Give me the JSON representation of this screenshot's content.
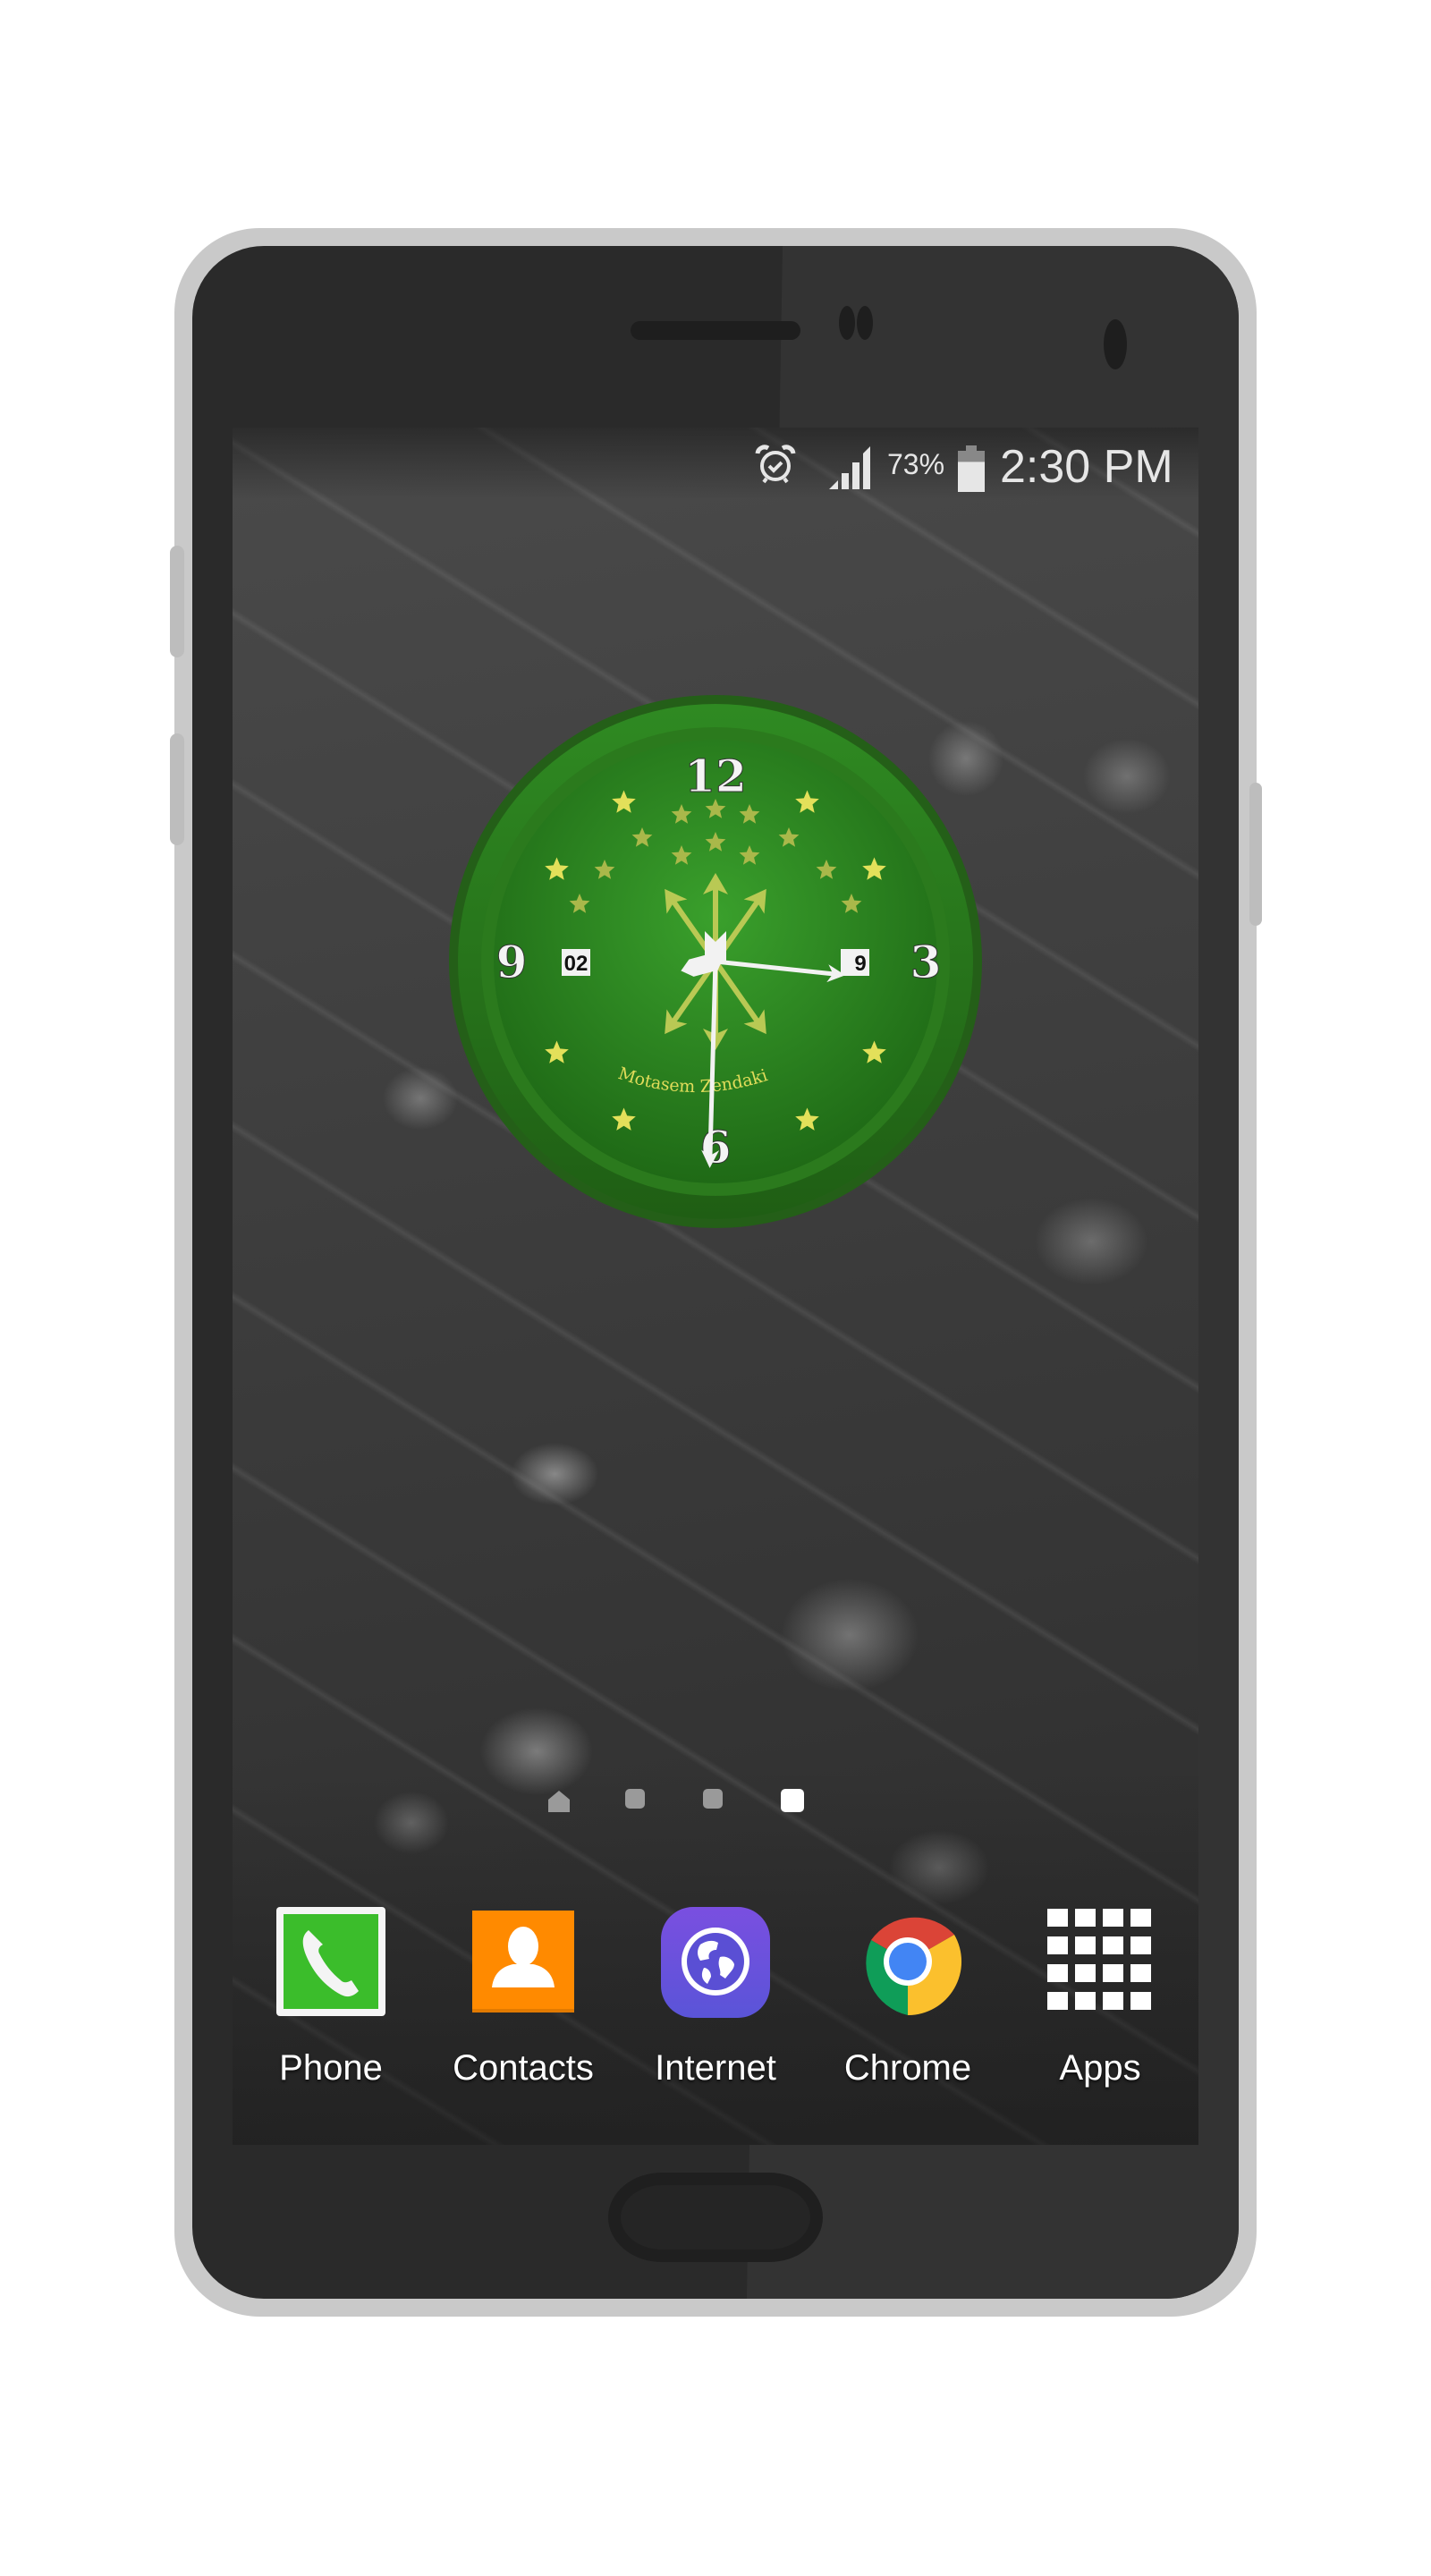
{
  "status_bar": {
    "icons": [
      "alarm-icon",
      "signal-icon",
      "battery-icon"
    ],
    "battery_percent": "73%",
    "battery_level": 0.73,
    "time": "2:30 PM"
  },
  "clock_widget": {
    "numerals": {
      "twelve": "12",
      "three": "3",
      "six": "6",
      "nine": "9"
    },
    "left_window": "02",
    "right_window": "9",
    "brand_text": "Motasem Zendaki",
    "time_shown": {
      "hour": 2,
      "minute": 30,
      "second": 16
    },
    "colors": {
      "ring": "#2f7d1e",
      "face": "#2e8a22",
      "stars": "#e3e05a",
      "arrows": "#b9c954",
      "hands": "#f2f2f2"
    }
  },
  "page_indicators": {
    "pages": [
      "home",
      "page",
      "page",
      "page"
    ],
    "active_index": 3
  },
  "dock": {
    "apps": [
      {
        "label": "Phone",
        "icon": "phone-icon",
        "color": "#3bbd2b"
      },
      {
        "label": "Contacts",
        "icon": "contacts-icon",
        "color": "#ff8a00"
      },
      {
        "label": "Internet",
        "icon": "internet-globe-icon",
        "color": "#6a4fd8"
      },
      {
        "label": "Chrome",
        "icon": "chrome-icon",
        "color": "#4285f4"
      },
      {
        "label": "Apps",
        "icon": "apps-grid-icon",
        "color": "#ffffff"
      }
    ]
  }
}
